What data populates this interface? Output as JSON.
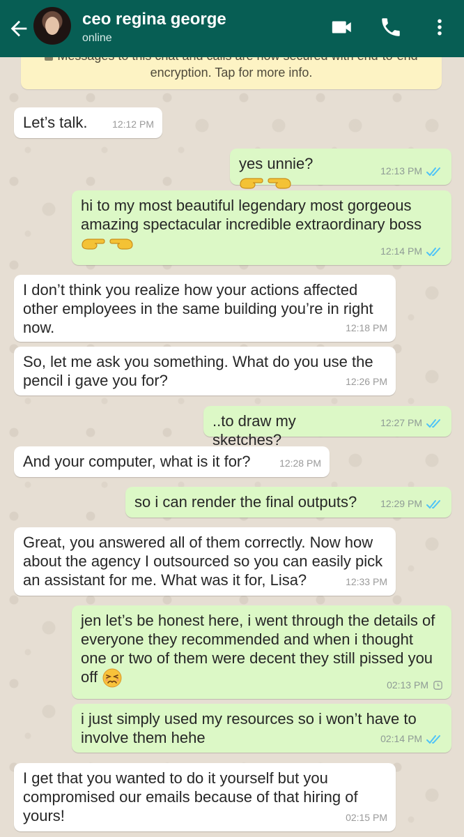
{
  "header": {
    "contact_name": "ceo regina george",
    "status": "online"
  },
  "banner": {
    "text": "Messages to this chat and calls are now secured with end-to-end encryption. Tap for more info."
  },
  "messages": [
    {
      "dir": "in",
      "text": "Let’s talk.",
      "time": "12:12 PM"
    },
    {
      "dir": "out",
      "text": "yes unnie?",
      "emoji": "pointing-fingers",
      "time": "12:13 PM",
      "status": "read"
    },
    {
      "dir": "out",
      "text": "hi to my most beautiful legendary most gorgeous amazing spectacular incredible extraordinary boss",
      "emoji": "pointing-fingers",
      "time": "12:14 PM",
      "status": "read"
    },
    {
      "dir": "in",
      "text": "I don’t think you realize how your actions affected other employees in the same building you’re in right now.",
      "time": "12:18 PM"
    },
    {
      "dir": "in",
      "text": "So, let me ask you something. What do you use the pencil i gave you for?",
      "time": "12:26 PM"
    },
    {
      "dir": "out",
      "text": "..to draw my sketches?",
      "time": "12:27 PM",
      "status": "read"
    },
    {
      "dir": "in",
      "text": "And your computer, what is it for?",
      "time": "12:28 PM"
    },
    {
      "dir": "out",
      "text": "so i can render the final outputs?",
      "time": "12:29 PM",
      "status": "read"
    },
    {
      "dir": "in",
      "text": "Great, you answered all of them correctly. Now how about the agency I outsourced so you can easily pick an assistant for me. What was it for, Lisa?",
      "time": "12:33 PM"
    },
    {
      "dir": "out",
      "text": "jen let’s be honest here, i went through the details of everyone they recommended and when i thought one or two of them were decent they still pissed you off",
      "emoji": "persevering-face",
      "time": "02:13 PM",
      "status": "pending"
    },
    {
      "dir": "out",
      "text": "i just simply used my resources so i won’t have to involve them hehe",
      "time": "02:14 PM",
      "status": "read"
    },
    {
      "dir": "in",
      "text": "I get that you wanted to do it yourself but you compromised our emails because of that hiring of yours!",
      "time": "02:15 PM"
    }
  ],
  "colors": {
    "header": "#075e54",
    "outgoing_bubble": "#dcf8c6",
    "incoming_bubble": "#ffffff",
    "read_tick": "#4fc3f7",
    "wallpaper": "#e6ded3"
  }
}
